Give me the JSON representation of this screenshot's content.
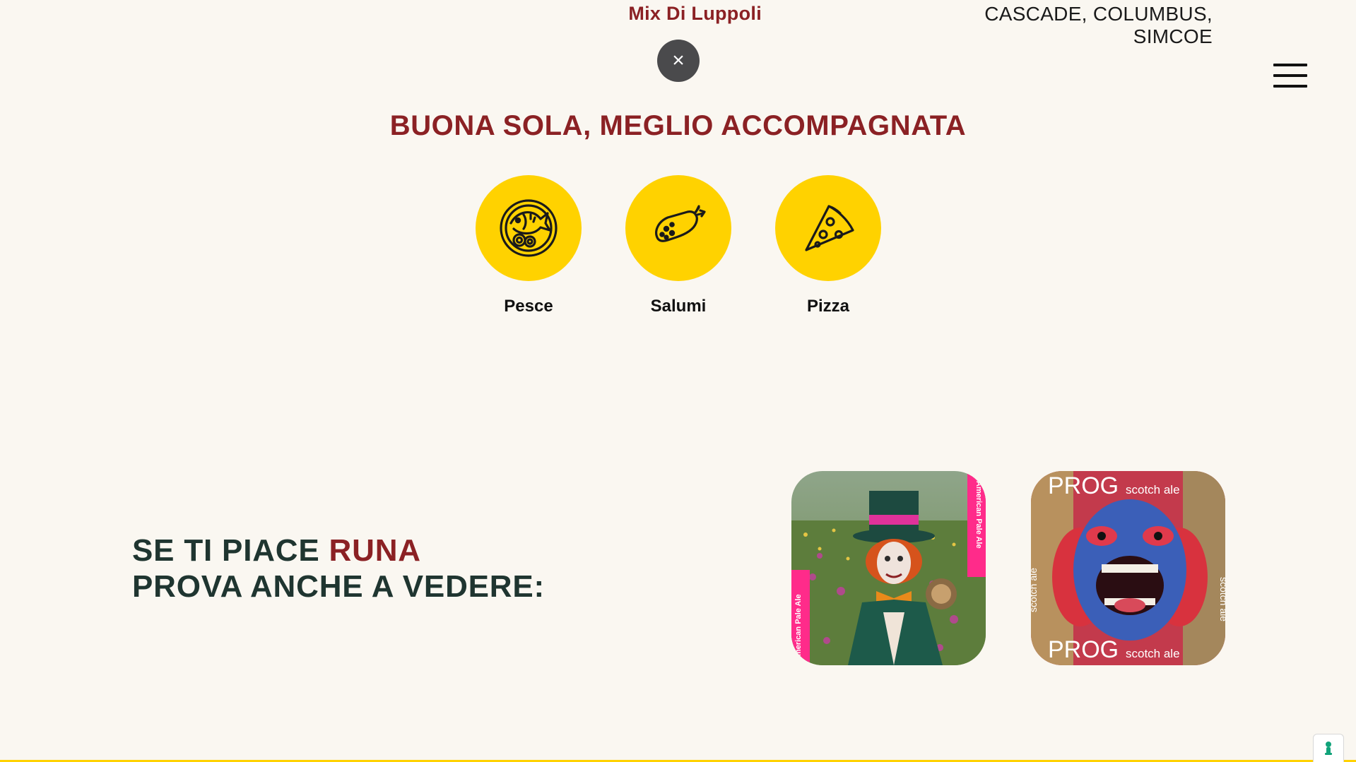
{
  "beer_info": {
    "hops_label": "Mix Di Luppoli",
    "hops_value": "CASCADE, COLUMBUS, SIMCOE"
  },
  "close_button": {
    "symbol": "×",
    "icon": "close-icon"
  },
  "menu": {
    "icon": "hamburger-menu-icon"
  },
  "pairing": {
    "title": "BUONA SOLA, MEGLIO ACCOMPAGNATA",
    "items": [
      {
        "label": "Pesce",
        "icon": "fish-plate-icon"
      },
      {
        "label": "Salumi",
        "icon": "salami-icon"
      },
      {
        "label": "Pizza",
        "icon": "pizza-slice-icon"
      }
    ],
    "circle_color": "#ffd200"
  },
  "suggestions": {
    "line1_prefix": "SE TI PIACE ",
    "line1_beer": "RUNA",
    "line2": "PROVA ANCHE A VEDERE:",
    "beers": [
      {
        "side_text": "American Pale Ale",
        "image": "mad-hatter-in-flower-field"
      },
      {
        "brand": "PROG",
        "style": "scotch ale",
        "image": "screaming-blue-red-face"
      }
    ]
  },
  "colors": {
    "accent": "#8b2124",
    "dark_green": "#1f3530",
    "yellow": "#ffd200",
    "background": "#faf7f1"
  },
  "cookie_widget": {
    "icon": "cookie-consent-icon"
  }
}
